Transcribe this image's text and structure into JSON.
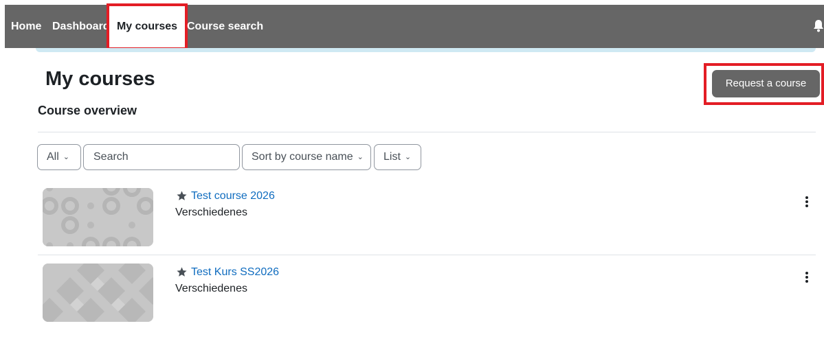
{
  "nav": {
    "home": "Home",
    "dashboard": "Dashboard",
    "my_courses": "My courses",
    "course_search": "Course search"
  },
  "page": {
    "title": "My courses",
    "section": "Course overview",
    "request_button": "Request a course"
  },
  "filters": {
    "grouping": "All",
    "search_placeholder": "Search",
    "sort": "Sort by course name",
    "view": "List"
  },
  "courses": [
    {
      "name": "Test course 2026",
      "category": "Verschiedenes",
      "starred_icon": "star-icon"
    },
    {
      "name": "Test Kurs SS2026",
      "category": "Verschiedenes",
      "starred_icon": "star-icon"
    }
  ],
  "colors": {
    "navbar": "#666666",
    "highlight": "#e31d25",
    "link": "#0f6cbf",
    "button": "#666666"
  }
}
